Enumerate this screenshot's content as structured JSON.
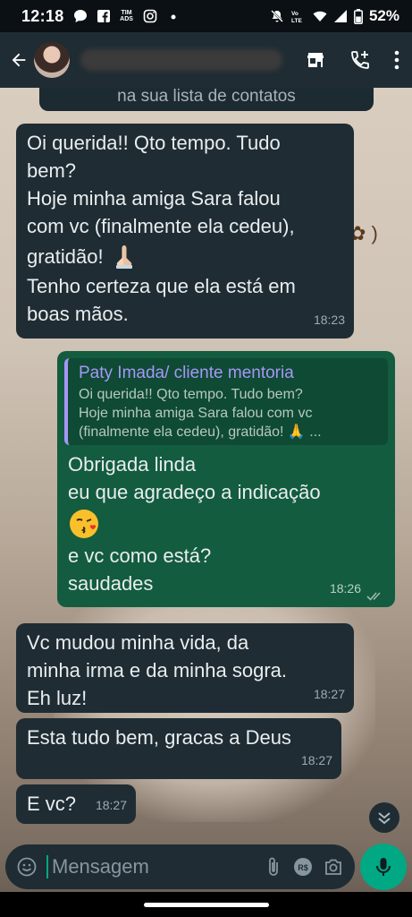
{
  "status_bar": {
    "time": "12:18",
    "battery": "52%",
    "left_icons": [
      "chat-bubble-icon",
      "facebook-icon",
      "tim-ads-icon",
      "instagram-icon",
      "dot-icon"
    ],
    "right_icons": [
      "mute-icon",
      "volte-icon",
      "wifi-icon",
      "signal-icon",
      "battery-icon"
    ],
    "tim_label": "TIM ADS"
  },
  "header": {
    "icons": [
      "back-arrow-icon",
      "store-icon",
      "add-call-icon",
      "more-vert-icon"
    ]
  },
  "chat": {
    "system_note": "na sua lista de contatos",
    "messages": [
      {
        "direction": "in",
        "lines": [
          "Oi querida!! Qto tempo. Tudo",
          "bem?",
          "Hoje minha amiga Sara falou",
          "com vc (finalmente ela cedeu),",
          "gratidão!",
          "Tenho certeza que ela está em",
          "boas mãos."
        ],
        "time": "18:23"
      },
      {
        "direction": "out",
        "reply": {
          "author": "Paty Imada/ cliente mentoria",
          "text1": "Oi querida!! Qto tempo. Tudo bem?",
          "text2": "Hoje minha amiga Sara falou com vc",
          "text3": "(finalmente ela cedeu), gratidão! 🙏 ..."
        },
        "lines": [
          "Obrigada linda",
          "eu que agradeço a indicação",
          "e vc como está?",
          "saudades"
        ],
        "time": "18:26",
        "status": "read"
      },
      {
        "direction": "in",
        "lines": [
          "Vc mudou minha vida, da",
          "minha irma e da minha sogra.",
          "Eh luz!"
        ],
        "time": "18:27"
      },
      {
        "direction": "in",
        "lines": [
          "Esta tudo bem, gracas a Deus"
        ],
        "time": "18:27"
      },
      {
        "direction": "in",
        "lines": [
          "E vc?"
        ],
        "time": "18:27"
      }
    ]
  },
  "composer": {
    "placeholder": "Mensagem",
    "icons": [
      "emoji-icon",
      "attach-icon",
      "payment-icon",
      "camera-icon",
      "mic-icon"
    ]
  },
  "colors": {
    "incoming_bubble": "#1f2c33",
    "outgoing_bubble": "#135c3f",
    "accent": "#00a884",
    "reply_author": "#a796f6"
  }
}
